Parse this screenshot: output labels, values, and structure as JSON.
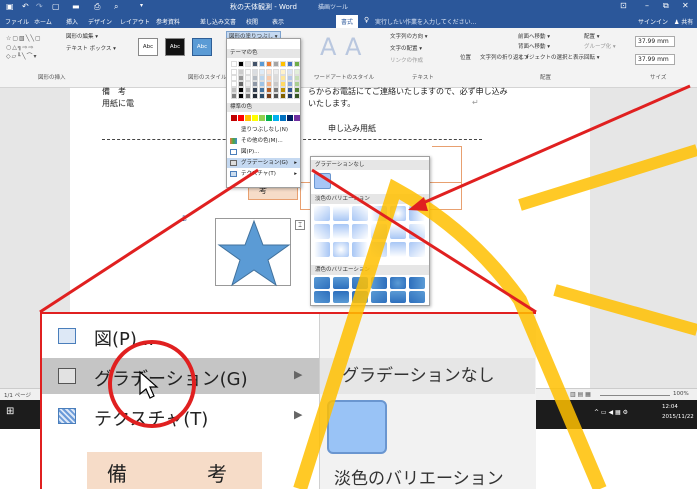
{
  "titlebar": {
    "doc_title": "秋の天体観測 - Word",
    "context_tab": "描画ツール",
    "quick_access": [
      "save-icon",
      "undo-icon",
      "redo-icon",
      "new-icon",
      "open-icon",
      "print-icon",
      "preview-icon",
      "customize-icon"
    ],
    "window_controls": [
      "ribbon-options-icon",
      "minimize-icon",
      "restore-icon",
      "close-icon"
    ]
  },
  "ribbon_tabs": [
    "ファイル",
    "ホーム",
    "挿入",
    "デザイン",
    "レイアウト",
    "参考資料",
    "差し込み文書",
    "校閲",
    "表示",
    "書式"
  ],
  "active_tab": "書式",
  "tell_me": "実行したい作業を入力してください...",
  "account": {
    "signin": "サインイン",
    "share": "共有"
  },
  "ribbon": {
    "edit_shape": "図形の編集 ▾",
    "text_box": "テキスト ボックス ▾",
    "group_insert_shapes": "図形の挿入",
    "style_labels": [
      "Abc",
      "Abc",
      "Abc"
    ],
    "shape_fill_button": "図形の塗りつぶし ▾",
    "group_shape_styles": "図形のスタイル",
    "group_wordart": "ワードアートのスタイル",
    "text_direction": "文字列の方向 ▾",
    "align_text": "文字の配置 ▾",
    "create_link": "リンクの作成",
    "group_text": "テキスト",
    "position": "位置",
    "wrap_text": "文字列の折り返し ▾",
    "bring_forward": "前面へ移動 ▾",
    "send_backward": "背面へ移動 ▾",
    "selection_pane": "オブジェクトの選択と表示",
    "align": "配置 ▾",
    "group": "グループ化 ▾",
    "rotate": "回転 ▾",
    "group_arrange": "配置",
    "height": "37.99 mm",
    "width": "37.99 mm",
    "group_size": "サイズ"
  },
  "color_menu": {
    "theme_colors": "テーマの色",
    "standard_colors": "標準の色",
    "no_fill": "塗りつぶしなし(N)",
    "more_colors": "その他の色(M)...",
    "picture": "図(P)...",
    "gradient": "グラデーション(G)",
    "texture": "テクスチャ(T)",
    "theme_swatches": [
      "#ffffff",
      "#000000",
      "#e7e6e6",
      "#44546a",
      "#5b9bd5",
      "#ed7d31",
      "#a5a5a5",
      "#ffc000",
      "#4472c4",
      "#70ad47"
    ],
    "standard_swatches": [
      "#c00000",
      "#ff0000",
      "#ffc000",
      "#ffff00",
      "#92d050",
      "#00b050",
      "#00b0f0",
      "#0070c0",
      "#002060",
      "#7030a0"
    ]
  },
  "gradient_menu": {
    "no_gradient": "グラデーションなし",
    "light_variations": "淡色のバリエーション",
    "dark_variations": "濃色のバリエーション",
    "light_color": "#a7c6f5",
    "dark_color": "#2d6fbd"
  },
  "document": {
    "line1": "備　考",
    "line1_rest": "らからお電話にてご連絡いたしますので、必ず申し込み",
    "line2": "用紙に電",
    "line2_rest": "いたします。",
    "return_mark": "↵",
    "application_form": "申し込み用紙",
    "field_bikou": "考",
    "star_color": "#5b9bd5"
  },
  "status": {
    "page": "1/1 ページ",
    "zoom_pct": "100%"
  },
  "taskbar": {
    "time": "12:04",
    "date": "2015/11/22"
  },
  "zoom_callout": {
    "picture": "図(P)...",
    "gradient": "グラデーション(G)",
    "texture": "テクスチャ(T)",
    "no_gradient": "グラデーションなし",
    "light_variations": "淡色のバリエーション",
    "bikou": "備",
    "bikou2": "考"
  },
  "annotation_color": "#e02020",
  "highlight_stroke_color": "#ffc000"
}
